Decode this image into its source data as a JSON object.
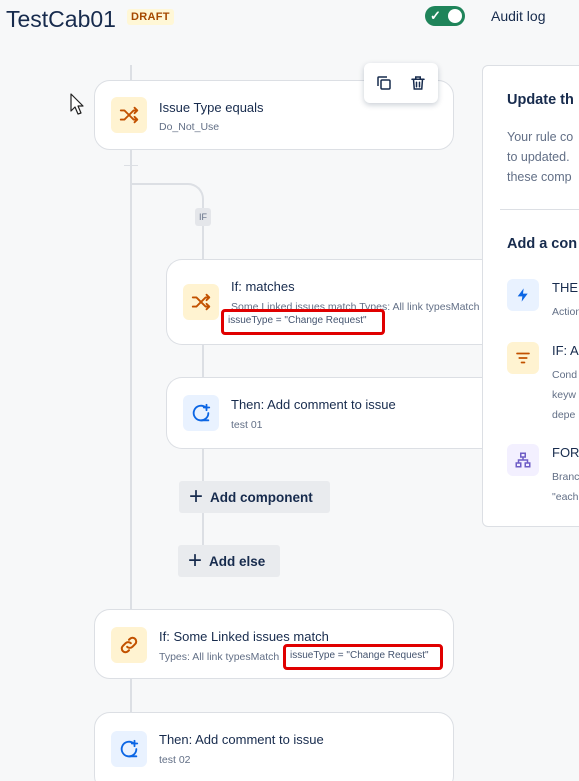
{
  "header": {
    "title": "TestCab01",
    "status_badge": "DRAFT",
    "toggle_on": true,
    "audit_log": "Audit log"
  },
  "flow": {
    "condition1": {
      "title": "Issue Type equals",
      "subtitle": "Do_Not_Use",
      "icon": "shuffle-icon"
    },
    "card_toolbar": {
      "duplicate_icon": "copy-icon",
      "delete_icon": "trash-icon"
    },
    "branch_label": "IF",
    "if_matches": {
      "title": "If: matches",
      "subtitle": "Some Linked issues match Types: All link typesMatch",
      "jql": "issueType = \"Change Request\"",
      "icon": "shuffle-icon"
    },
    "then1": {
      "title": "Then: Add comment to issue",
      "subtitle": "test 01",
      "icon": "comment-add-icon"
    },
    "add_component": "Add component",
    "add_else": "Add else",
    "if_linked": {
      "title": "If: Some Linked issues match",
      "subtitle": "Types: All link typesMatch",
      "jql": "issueType = \"Change Request\"",
      "icon": "link-icon"
    },
    "then2": {
      "title": "Then: Add comment to issue",
      "subtitle": "test 02",
      "icon": "comment-add-icon"
    }
  },
  "panel": {
    "heading": "Update th",
    "description": [
      "Your rule co",
      "to updated.",
      "these comp"
    ],
    "add_heading": "Add a con",
    "items": [
      {
        "title": "THEN",
        "lines": [
          "Action"
        ],
        "icon": "lightning-icon",
        "color": "#e9f2ff"
      },
      {
        "title": "IF: A",
        "lines": [
          "Cond",
          "keyw",
          "depe"
        ],
        "icon": "filter-icon",
        "color": "#fff3d1"
      },
      {
        "title": "FOR",
        "lines": [
          "Branc",
          "\"each"
        ],
        "icon": "branch-icon",
        "color": "#f3f0ff"
      }
    ]
  },
  "colors": {
    "accent_toggle": "#1f845a",
    "highlight_red": "#e00000",
    "draft_text": "#a54800"
  }
}
